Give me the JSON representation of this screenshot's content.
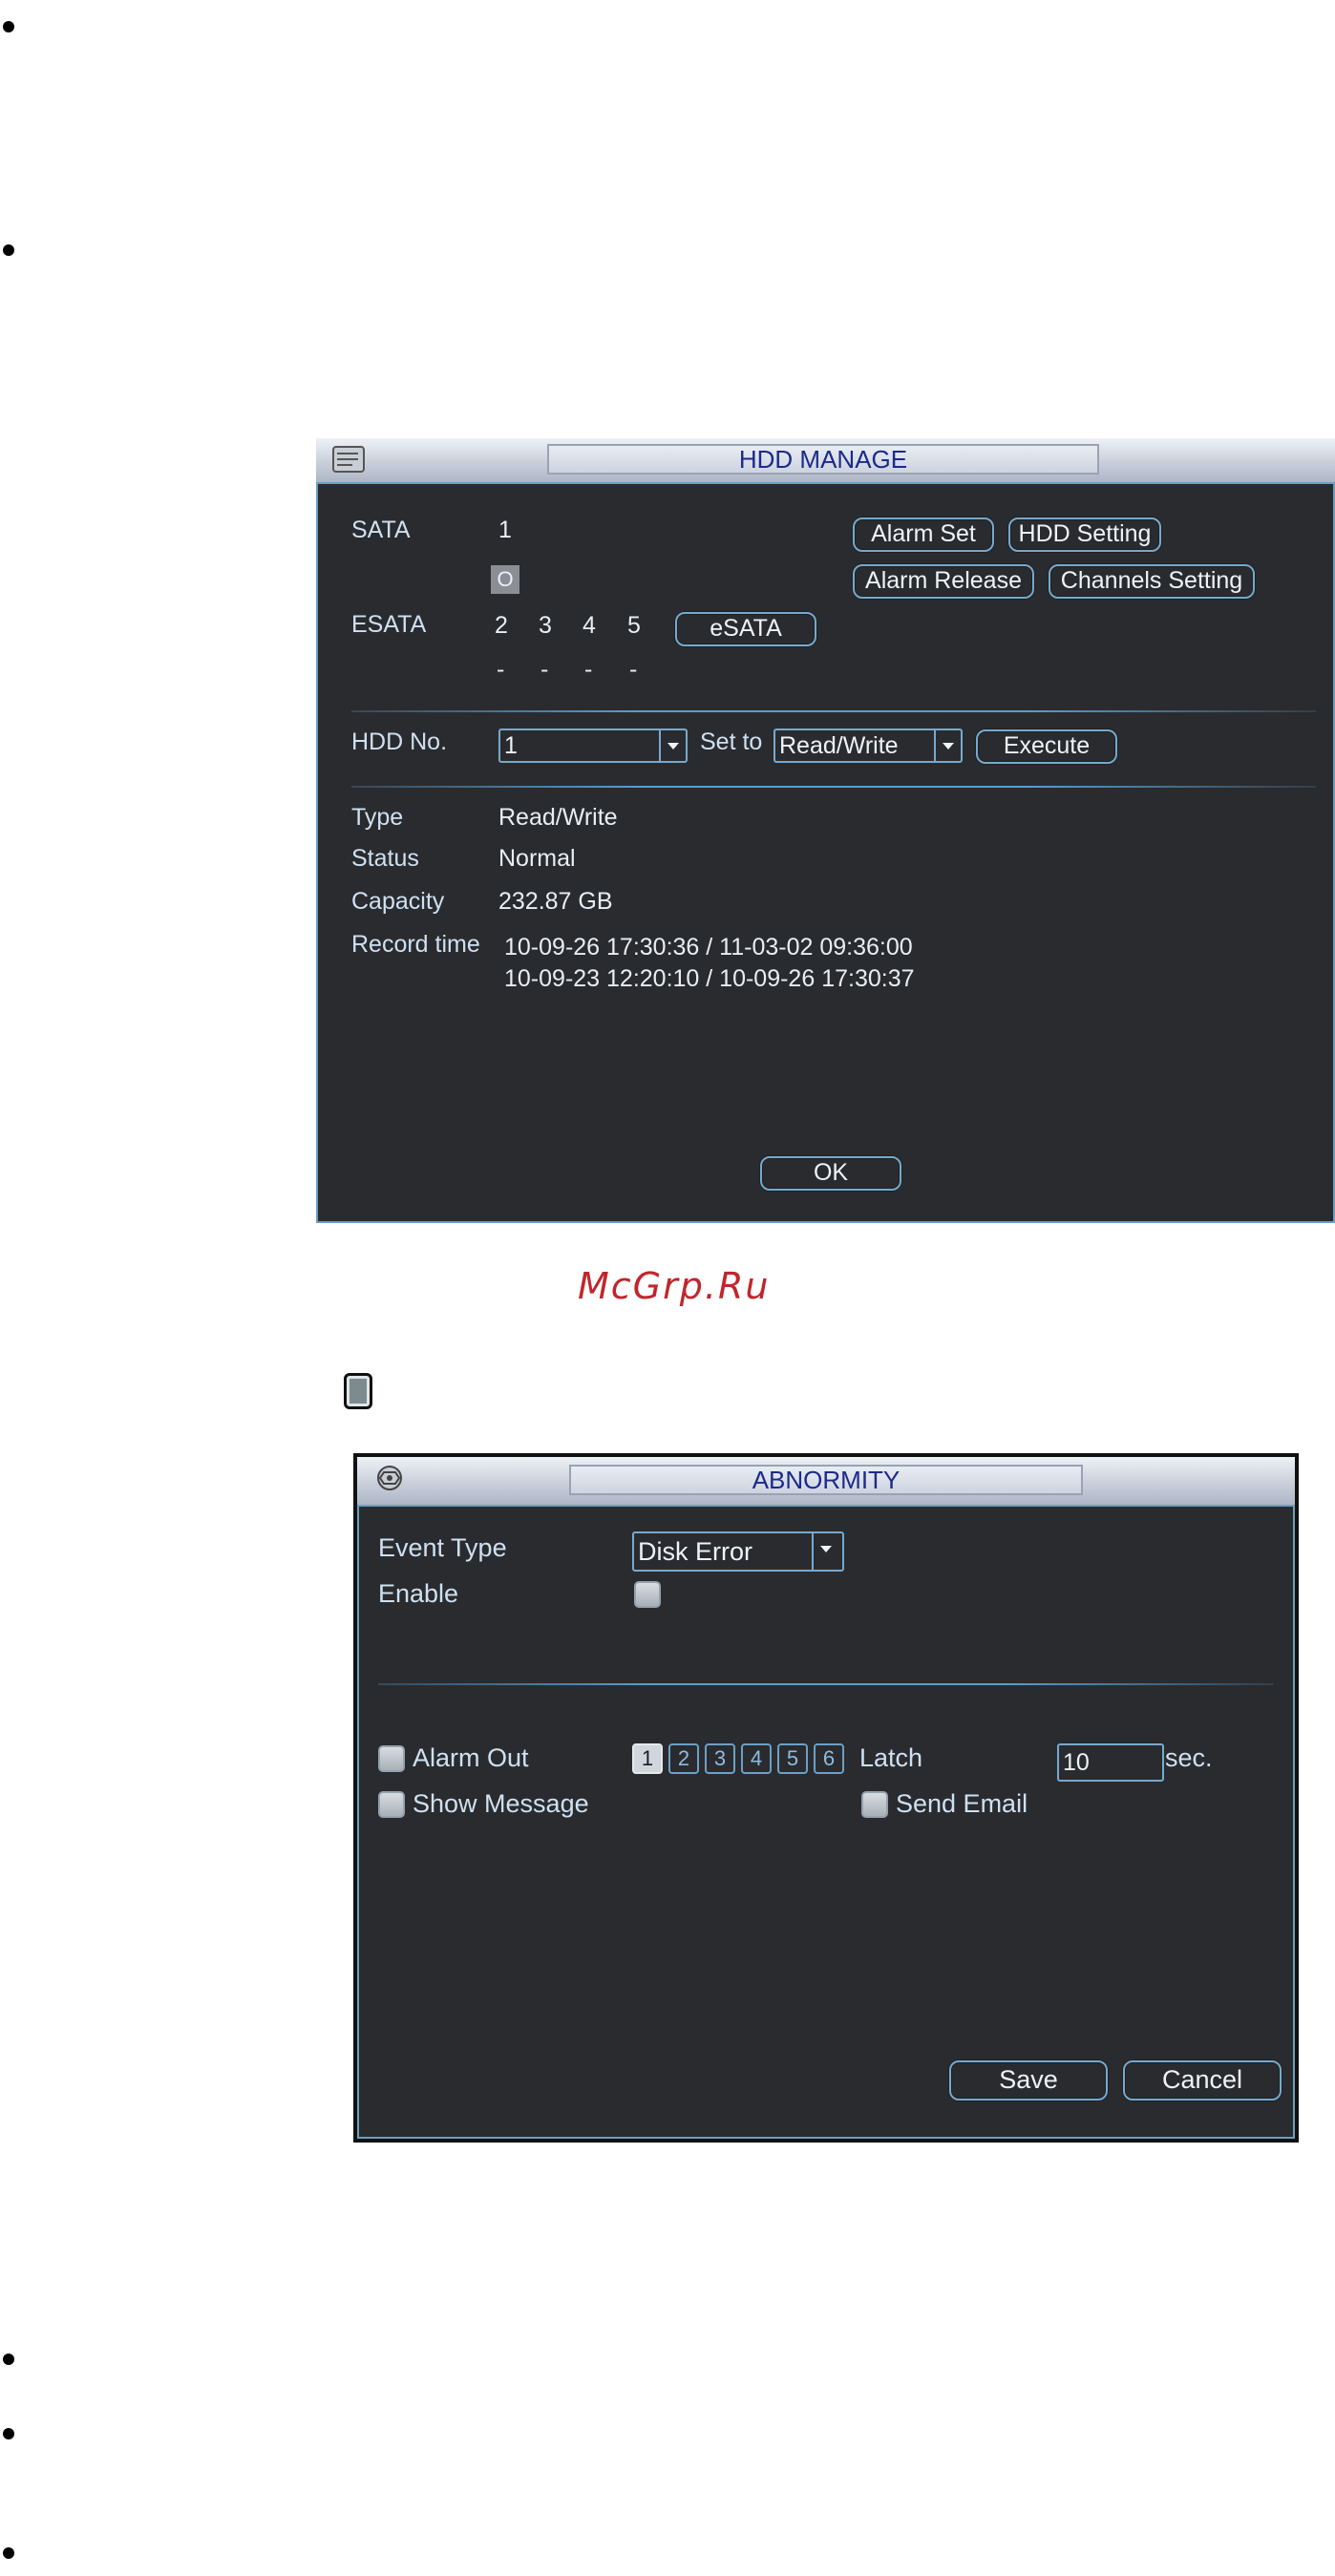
{
  "hdd_manage": {
    "title": "HDD MANAGE",
    "sata_label": "SATA",
    "sata_port": "1",
    "sata_slot_marker": "O",
    "esata_label": "ESATA",
    "esata_ports": [
      "2",
      "3",
      "4",
      "5"
    ],
    "esata_port_status": [
      "-",
      "-",
      "-",
      "-"
    ],
    "esata_button": "eSATA",
    "alarm_set_button": "Alarm Set",
    "hdd_setting_button": "HDD Setting",
    "alarm_release_button": "Alarm Release",
    "channels_setting_button": "Channels Setting",
    "hdd_no_label": "HDD No.",
    "hdd_no_value": "1",
    "set_to_label": "Set to",
    "set_to_value": "Read/Write",
    "execute_button": "Execute",
    "type_label": "Type",
    "type_value": "Read/Write",
    "status_label": "Status",
    "status_value": "Normal",
    "capacity_label": "Capacity",
    "capacity_value": "232.87 GB",
    "record_time_label": "Record time",
    "record_times": [
      "10-09-26 17:30:36 / 11-03-02 09:36:00",
      "10-09-23 12:20:10 / 10-09-26 17:30:37"
    ],
    "ok_button": "OK"
  },
  "watermark": "McGrp.Ru",
  "abnormity": {
    "title": "ABNORMITY",
    "event_type_label": "Event Type",
    "event_type_value": "Disk Error",
    "enable_label": "Enable",
    "alarm_out_label": "Alarm Out",
    "alarm_out_channels": [
      "1",
      "2",
      "3",
      "4",
      "5",
      "6"
    ],
    "latch_label": "Latch",
    "latch_value": "10",
    "latch_unit": "sec.",
    "show_message_label": "Show Message",
    "send_email_label": "Send Email",
    "save_button": "Save",
    "cancel_button": "Cancel"
  },
  "colors": {
    "window_bg": "#2a2b2e",
    "accent_border": "#77a9cf",
    "title_text": "#1c2a8a",
    "watermark": "#c0262c"
  },
  "icons": [
    "bullet-icon",
    "hdd-icon",
    "network-gear-icon",
    "chevron-down-icon",
    "checkbox-icon"
  ]
}
